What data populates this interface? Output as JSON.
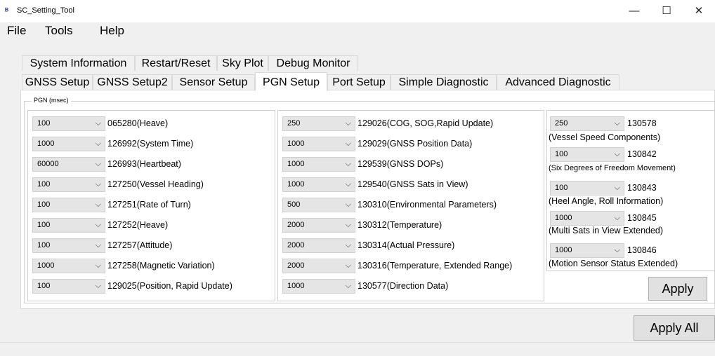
{
  "window": {
    "title": "SC_Setting_Tool",
    "app_icon": "app-logo-icon",
    "minimize": "—",
    "maximize": "☐",
    "close": "✕"
  },
  "menu": [
    "File",
    "Tools",
    "Help"
  ],
  "tabs_row1": [
    "System Information",
    "Restart/Reset",
    "Sky Plot",
    "Debug Monitor"
  ],
  "tabs_row2": [
    "GNSS Setup",
    "GNSS Setup2",
    "Sensor Setup",
    "PGN Setup",
    "Port Setup",
    "Simple Diagnostic",
    "Advanced Diagnostic"
  ],
  "active_tab": "PGN Setup",
  "group_title": "PGN (msec)",
  "col1": [
    {
      "value": "100",
      "label": "065280(Heave)"
    },
    {
      "value": "1000",
      "label": "126992(System Time)"
    },
    {
      "value": "60000",
      "label": "126993(Heartbeat)"
    },
    {
      "value": "100",
      "label": "127250(Vessel Heading)"
    },
    {
      "value": "100",
      "label": "127251(Rate of Turn)"
    },
    {
      "value": "100",
      "label": "127252(Heave)"
    },
    {
      "value": "100",
      "label": "127257(Attitude)"
    },
    {
      "value": "1000",
      "label": "127258(Magnetic Variation)"
    },
    {
      "value": "100",
      "label": "129025(Position, Rapid Update)"
    }
  ],
  "col2": [
    {
      "value": "250",
      "label": "129026(COG, SOG,Rapid Update)"
    },
    {
      "value": "1000",
      "label": "129029(GNSS Position Data)"
    },
    {
      "value": "1000",
      "label": "129539(GNSS DOPs)"
    },
    {
      "value": "1000",
      "label": "129540(GNSS Sats in View)"
    },
    {
      "value": "500",
      "label": "130310(Environmental Parameters)"
    },
    {
      "value": "2000",
      "label": "130312(Temperature)"
    },
    {
      "value": "2000",
      "label": "130314(Actual Pressure)"
    },
    {
      "value": "2000",
      "label": "130316(Temperature, Extended Range)"
    },
    {
      "value": "1000",
      "label": "130577(Direction Data)"
    }
  ],
  "col3": [
    {
      "value": "250",
      "pgn": "130578",
      "desc": "(Vessel Speed Components)"
    },
    {
      "value": "100",
      "pgn": "130842",
      "desc": "(Six Degrees of Freedom Movement)"
    },
    {
      "value": "100",
      "pgn": "130843",
      "desc": "(Heel Angle, Roll Information)"
    },
    {
      "value": "1000",
      "pgn": "130845",
      "desc": "(Multi Sats in View Extended)"
    },
    {
      "value": "1000",
      "pgn": "130846",
      "desc": "(Motion Sensor Status Extended)"
    }
  ],
  "apply_label": "Apply",
  "apply_all_label": "Apply All"
}
